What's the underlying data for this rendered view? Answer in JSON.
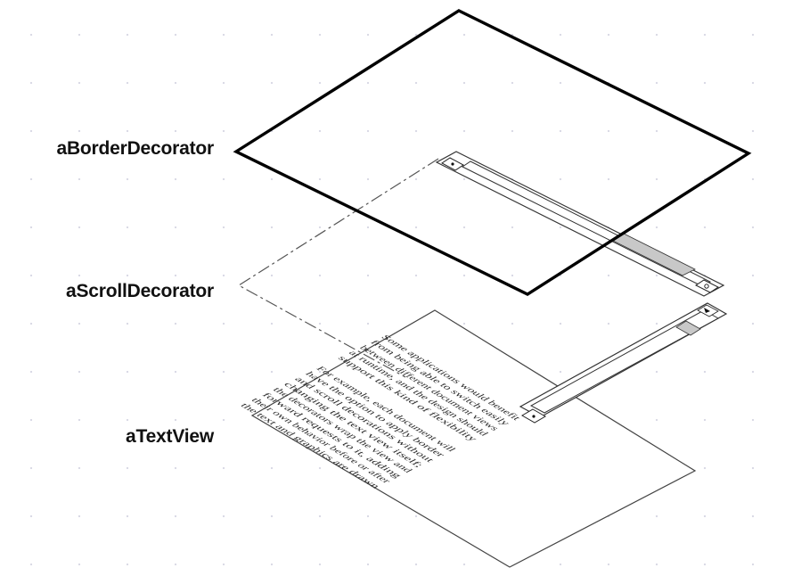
{
  "labels": {
    "border_decorator": "aBorderDecorator",
    "scroll_decorator": "aScrollDecorator",
    "text_view": "aTextView"
  },
  "text_view": {
    "lines": [
      "Some applications would benefit",
      "from being able to switch easily",
      "between different document views",
      "at runtime, and the design should",
      "support this kind of flexibility",
      "",
      "For example, each document will",
      "have the option to apply border",
      "and scroll decorations without",
      "changing the text view itself;",
      "the decorators wrap the view and",
      "forward requests to it, adding",
      "their own behavior before or after",
      "the text and graphics are drawn"
    ]
  },
  "colors": {
    "scroll_thumb": "#c8c8c8",
    "line": "#000000",
    "dashed": "#555555"
  }
}
